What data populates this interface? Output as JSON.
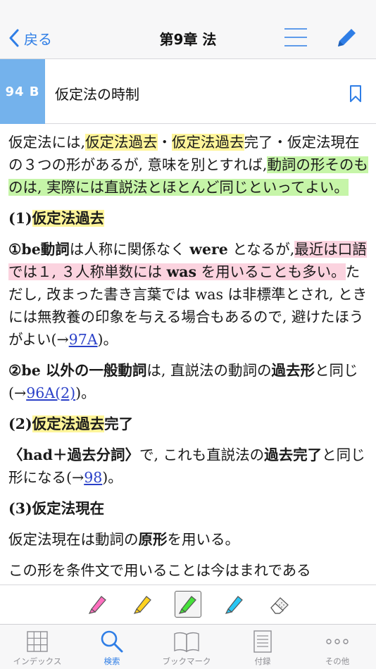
{
  "nav": {
    "back_label": "戻る",
    "title": "第9章 法"
  },
  "section": {
    "number": "94 B",
    "title": "仮定法の時制"
  },
  "content": {
    "p1": {
      "t1": "仮定法には,",
      "t2": "仮定法過去",
      "t3": "・",
      "t4": "仮定法過去",
      "t5": "完了・仮定法現在の３つの形があるが, 意味を別とすれば,",
      "t6": "動詞の形そのものは, 実際には直説法とほとんど同じといってよい。"
    },
    "h1": {
      "num": "(1)",
      "label": "仮定法過去"
    },
    "p2": {
      "t1": "①be動詞",
      "t2": "は人称に関係なく",
      "t3": "were",
      "t4": "となるが,",
      "t5": "最近は口語では１, ３人称単数には",
      "t6": "was",
      "t7": "を用いることも多い。",
      "t8": "ただし, 改まった書き言葉では was は非標準とされ, ときには無教養の印象を与える場合もあるので, 避けたほうがよい(→",
      "link": "97A",
      "t9": ")。"
    },
    "p3": {
      "t1": "②be 以外の一般動詞",
      "t2": "は, 直説法の動詞の",
      "t3": "過去形",
      "t4": "と同じ(→",
      "link": "96A(2)",
      "t5": ")。"
    },
    "h2": {
      "num": "(2)",
      "label": "仮定法過去",
      "suffix": "完了"
    },
    "p4": {
      "t1": "〈had＋過去分詞〉",
      "t2": "で, これも直説法の",
      "t3": "過去完了",
      "t4": "と同じ形になる(→",
      "link": "98",
      "t5": ")。"
    },
    "h3": {
      "label": "(3)仮定法現在"
    },
    "p5": {
      "t1": "仮定法現在は動詞の",
      "t2": "原形",
      "t3": "を用いる。"
    },
    "p6": {
      "t1": "この形を条件文で用いることは今はまれである"
    }
  },
  "highlighters": [
    {
      "name": "pink",
      "color": "#ff6fbf",
      "selected": false
    },
    {
      "name": "yellow",
      "color": "#ffd21f",
      "selected": false
    },
    {
      "name": "green",
      "color": "#46e23a",
      "selected": true
    },
    {
      "name": "blue",
      "color": "#29c6f4",
      "selected": false
    },
    {
      "name": "eraser",
      "color": "#cccccc",
      "selected": false
    }
  ],
  "tabs": [
    {
      "label": "インデックス",
      "icon": "grid-icon",
      "active": false
    },
    {
      "label": "検索",
      "icon": "search-icon",
      "active": true
    },
    {
      "label": "ブックマーク",
      "icon": "book-icon",
      "active": false
    },
    {
      "label": "付録",
      "icon": "document-icon",
      "active": false
    },
    {
      "label": "その他",
      "icon": "more-icon",
      "active": false
    }
  ],
  "colors": {
    "accent": "#2f7ee6",
    "section_badge": "#74b2ec",
    "highlight_yellow": "#fff59a",
    "highlight_green": "#c6f5a8",
    "highlight_pink": "#fbd3df",
    "link": "#2a40c8"
  }
}
